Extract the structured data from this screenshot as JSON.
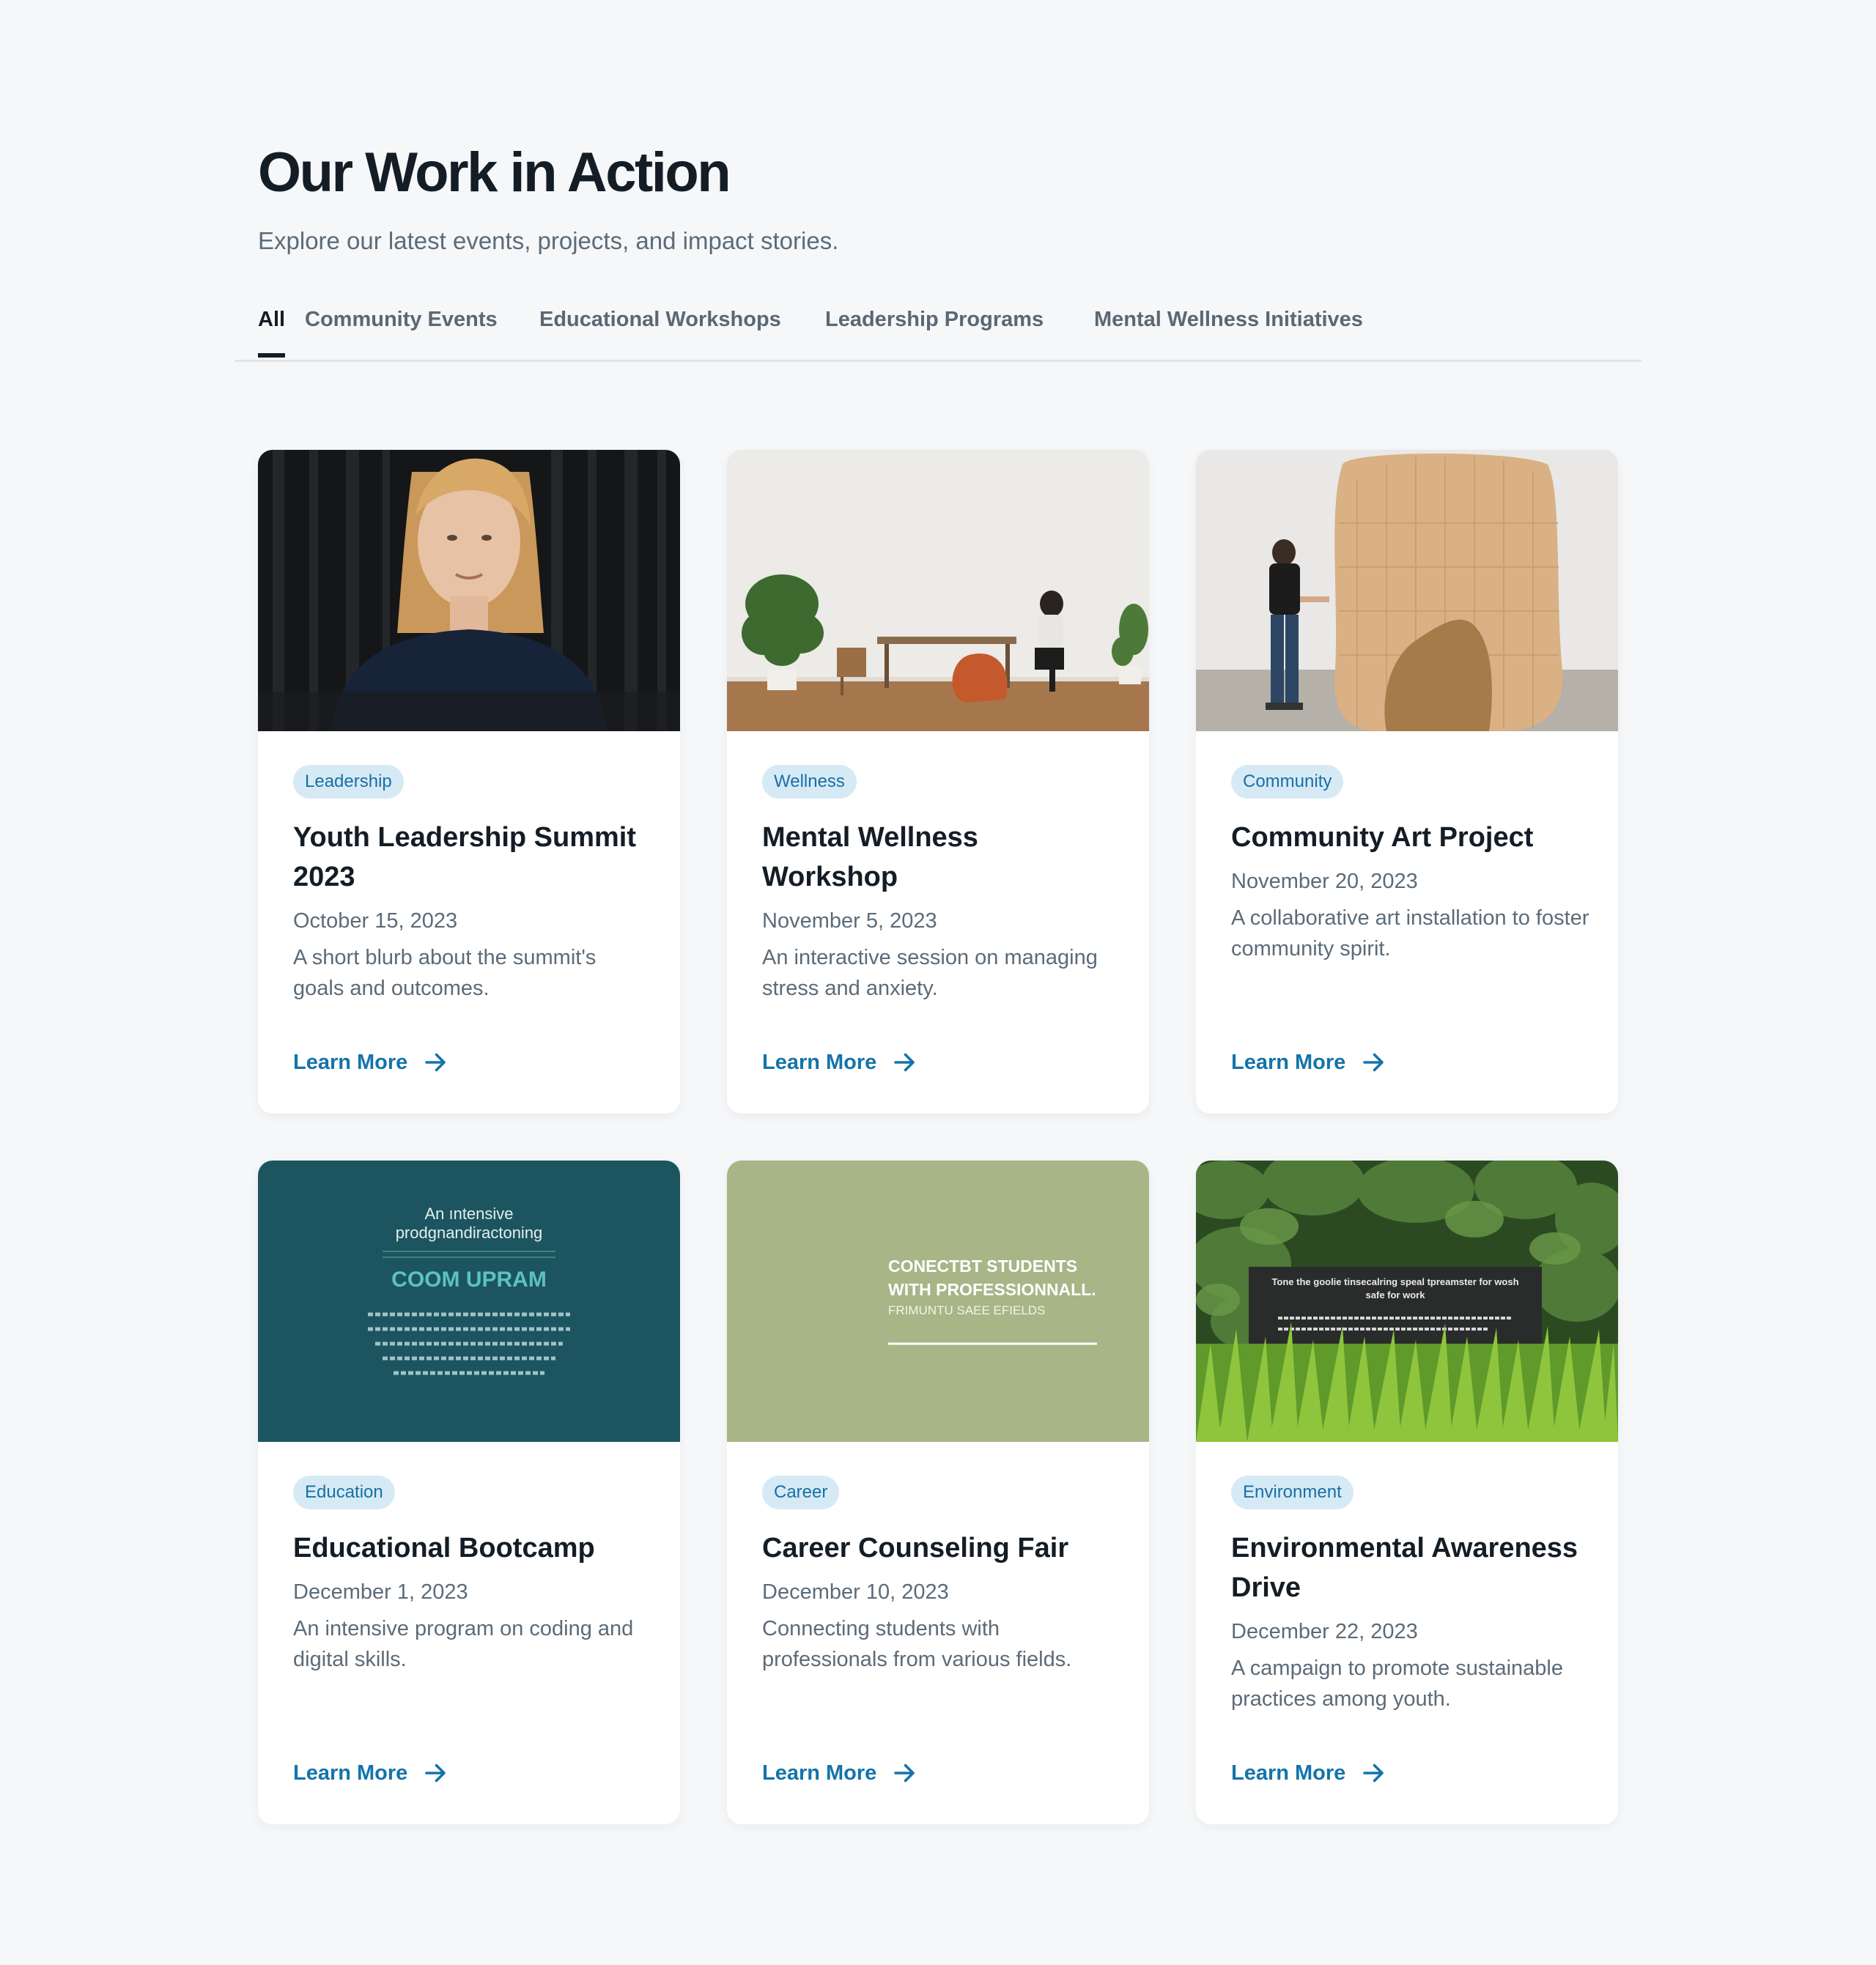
{
  "header": {
    "title": "Our Work in Action",
    "subtitle": "Explore our latest events, projects, and impact stories."
  },
  "tabs": [
    {
      "label": "All",
      "active": true
    },
    {
      "label": "Community Events",
      "active": false
    },
    {
      "label": "Educational Workshops",
      "active": false
    },
    {
      "label": "Leadership Programs",
      "active": false
    },
    {
      "label": "Mental Wellness Initiatives",
      "active": false
    }
  ],
  "colors": {
    "page_bg": "#f5f7f9",
    "title": "#141d26",
    "muted_text": "#5c6b78",
    "badge_bg": "#d6eaf5",
    "badge_text": "#1770a6",
    "link": "#1474aa"
  },
  "cards": [
    {
      "badge": "Leadership",
      "title": "Youth Leadership Summit 2023",
      "date": "October 15, 2023",
      "description": "A short blurb about the summit's goals and outcomes.",
      "link": "Learn More",
      "image": "woman-portrait-photo"
    },
    {
      "badge": "Wellness",
      "title": "Mental Wellness Workshop",
      "date": "November 5, 2023",
      "description": "An interactive session on managing stress and anxiety.",
      "link": "Learn More",
      "image": "room-with-table-photo"
    },
    {
      "badge": "Community",
      "title": "Community Art Project",
      "date": "November 20, 2023",
      "description": "A collaborative art installation to foster community spirit.",
      "link": "Learn More",
      "image": "art-installation-photo"
    },
    {
      "badge": "Education",
      "title": "Educational Bootcamp",
      "date": "December 1, 2023",
      "description": "An intensive program on coding and digital skills.",
      "link": "Learn More",
      "image": "teal-poster",
      "poster": {
        "line1": "An ıntensive",
        "line2": "prodgnandiractoning",
        "heading": "COOM UPRAM"
      }
    },
    {
      "badge": "Career",
      "title": "Career Counseling Fair",
      "date": "December 10, 2023",
      "description": "Connecting students with professionals from various fields.",
      "link": "Learn More",
      "image": "green-poster",
      "poster": {
        "line1": "CONECTBT STUDENTS",
        "line2": "WITH PROFESSIONNALL.",
        "line3": "FRIMUNTU SAEE EFIELDS"
      }
    },
    {
      "badge": "Environment",
      "title": "Environmental Awareness Drive",
      "date": "December 22, 2023",
      "description": "A campaign to promote sustainable practices among youth.",
      "link": "Learn More",
      "image": "sign-in-plants-photo",
      "sign": {
        "line1": "Tone the goolie tinsecalring speal tpreamster for wosh",
        "line2": "safe for work"
      }
    }
  ]
}
